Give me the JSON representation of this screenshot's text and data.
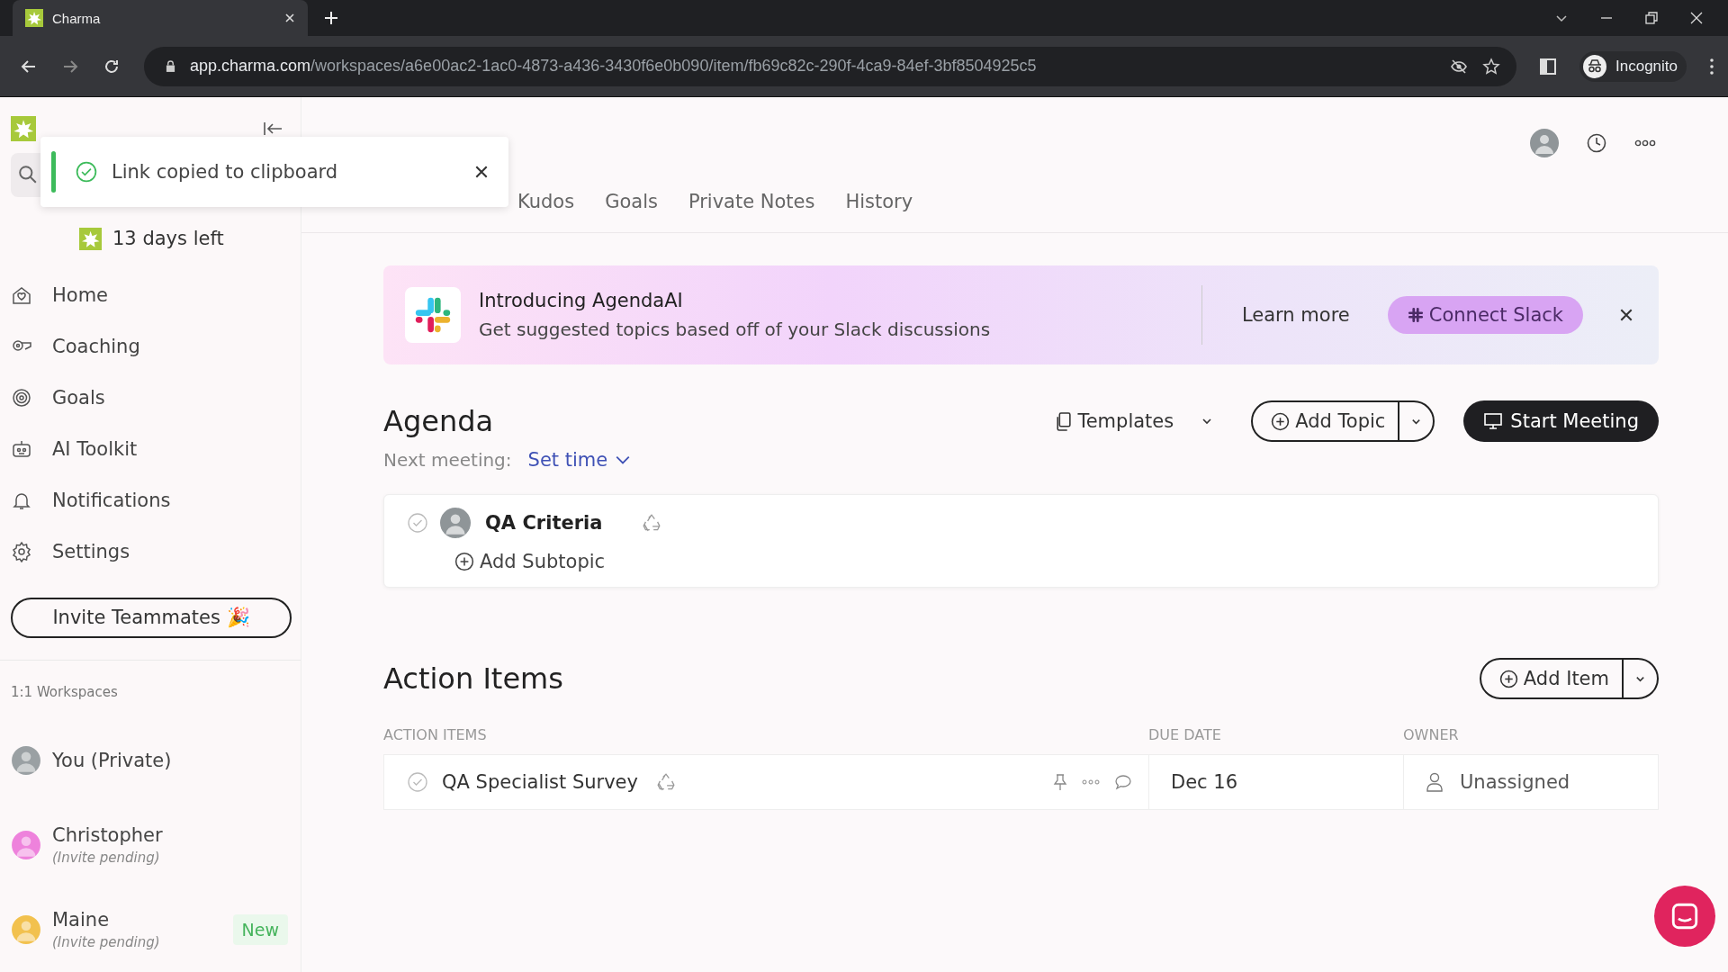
{
  "browser": {
    "tab_title": "Charma",
    "url_host": "app.charma.com",
    "url_path": "/workspaces/a6e00ac2-1ac0-4873-a436-3430f6e0b090/item/fb69c82c-290f-4ca9-84ef-3bf8504925c5",
    "profile": "Incognito"
  },
  "sidebar": {
    "trial": "13 days left",
    "nav": [
      {
        "label": "Home"
      },
      {
        "label": "Coaching"
      },
      {
        "label": "Goals"
      },
      {
        "label": "AI Toolkit"
      },
      {
        "label": "Notifications"
      },
      {
        "label": "Settings"
      }
    ],
    "invite_button": "Invite Teammates 🎉",
    "section_title": "1:1 Workspaces",
    "workspaces": [
      {
        "name": "You (Private)",
        "color": "#9aa0a3"
      },
      {
        "name": "Christopher",
        "status": "(Invite pending)",
        "color": "#ee82dc"
      },
      {
        "name": "Maine",
        "status": "(Invite pending)",
        "color": "#f2c14e",
        "badge": "New"
      }
    ]
  },
  "toast": {
    "message": "Link copied to clipboard"
  },
  "page": {
    "tabs": [
      {
        "label": "Kudos"
      },
      {
        "label": "Goals"
      },
      {
        "label": "Private Notes"
      },
      {
        "label": "History"
      }
    ]
  },
  "banner": {
    "title": "Introducing AgendaAI",
    "text": "Get suggested topics based off of your Slack discussions",
    "learn_more": "Learn more",
    "connect_button": "Connect Slack"
  },
  "agenda": {
    "heading": "Agenda",
    "templates": "Templates",
    "add_topic": "Add Topic",
    "start_meeting": "Start Meeting",
    "next_meeting_label": "Next meeting:",
    "next_meeting_value": "Set time",
    "topics": [
      {
        "title": "QA Criteria",
        "checked": false,
        "add_subtopic": "Add Subtopic"
      }
    ]
  },
  "action_items": {
    "heading": "Action Items",
    "add_item": "Add Item",
    "columns": [
      "ACTION ITEMS",
      "DUE DATE",
      "OWNER"
    ],
    "rows": [
      {
        "title": "QA Specialist Survey",
        "checked": false,
        "due": "Dec 16",
        "owner": "Unassigned"
      }
    ]
  }
}
